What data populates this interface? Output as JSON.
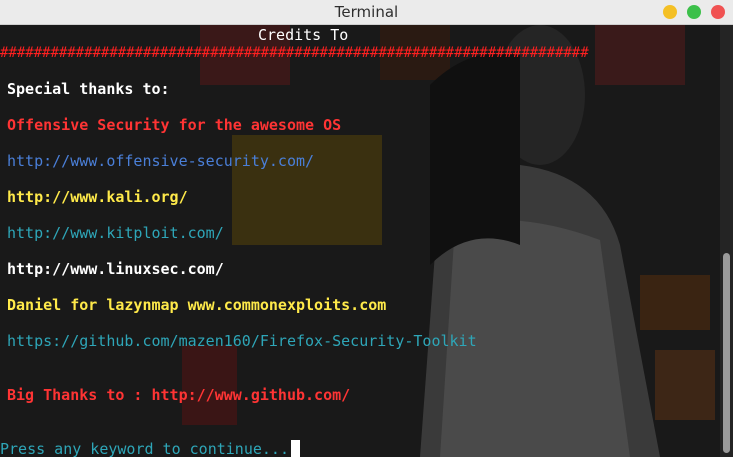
{
  "window": {
    "title": "Terminal"
  },
  "terminal": {
    "heading": "Credits To",
    "separator": "######################################################################",
    "special_thanks": "Special thanks to:",
    "offensive": "Offensive Security for the awesome OS",
    "offensive_url": "http://www.offensive-security.com/",
    "kali_url": "http://www.kali.org/",
    "kitploit_url": "http://www.kitploit.com/",
    "linuxsec_url": "http://www.linuxsec.com/",
    "lazynmap": "Daniel for lazynmap www.commonexploits.com",
    "github_toolkit": "https://github.com/mazen160/Firefox-Security-Toolkit",
    "big_thanks": "Big Thanks to : http://www.github.com/",
    "prompt": "Press any keyword to continue..."
  },
  "colors": {
    "red": "#ff3434",
    "blue": "#4a7fd8",
    "yellow": "#ffea4a",
    "cyan": "#2ea6b8",
    "white": "#ffffff"
  }
}
